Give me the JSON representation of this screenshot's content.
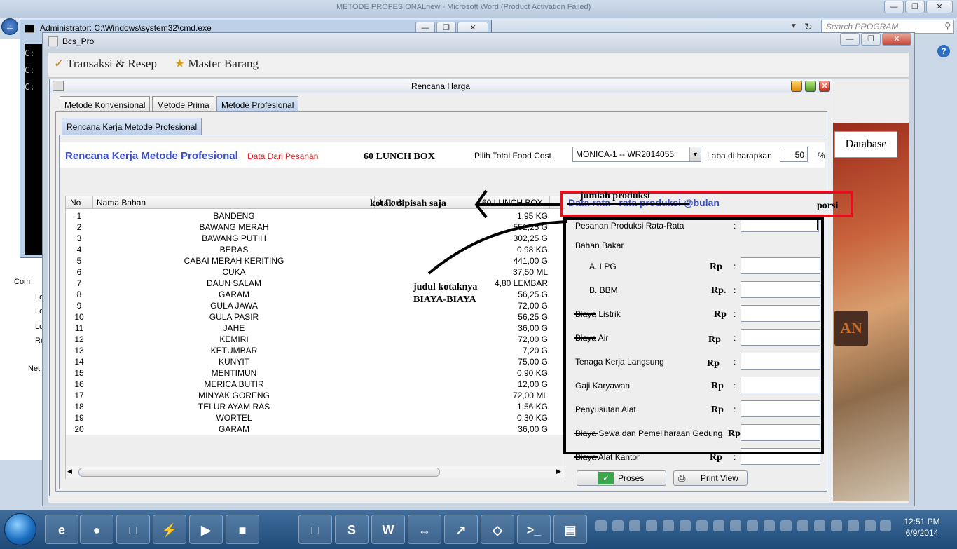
{
  "background": {
    "word_title": "METODE PROFESIONALnew - Microsoft Word (Product Activation Failed)",
    "search_placeholder": "Search PROGRAM",
    "explorer_items": [
      "Com",
      "Lo",
      "Lo",
      "Lo",
      "Re",
      "Net"
    ],
    "cmd_title": "Administrator: C:\\Windows\\system32\\cmd.exe",
    "cmd_lines": [
      "C:",
      "C:",
      "C:"
    ]
  },
  "app": {
    "title": "Bcs_Pro",
    "menu": [
      "Transaksi & Resep",
      "Master Barang"
    ],
    "bg_database": "Database",
    "bg_an": "AN"
  },
  "window": {
    "title": "Rencana Harga",
    "tabs": [
      "Metode Konvensional",
      "Metode Prima",
      "Metode Profesional"
    ],
    "subtab": "Rencana Kerja Metode Profesional"
  },
  "header": {
    "heading": "Rencana Kerja Metode Profesional",
    "source": "Data Dari Pesanan",
    "product": "60 LUNCH BOX",
    "foodcost_label": "Pilih Total Food Cost",
    "foodcost_value": "MONICA-1 -- WR2014055",
    "profit_label": "Laba di harapkan",
    "profit_value": "50",
    "percent": "%"
  },
  "table": {
    "columns": [
      "No",
      "Nama Bahan",
      "1 Porsi",
      "60 LUNCH BOX"
    ],
    "rows": [
      [
        "1",
        "BANDENG",
        "",
        "1,95 KG"
      ],
      [
        "2",
        "BAWANG MERAH",
        "",
        "551,25 G"
      ],
      [
        "3",
        "BAWANG PUTIH",
        "",
        "302,25 G"
      ],
      [
        "4",
        "BERAS",
        "",
        "0,98 KG"
      ],
      [
        "5",
        "CABAI MERAH KERITING",
        "",
        "441,00 G"
      ],
      [
        "6",
        "CUKA",
        "",
        "37,50 ML"
      ],
      [
        "7",
        "DAUN SALAM",
        "",
        "4,80 LEMBAR"
      ],
      [
        "8",
        "GARAM",
        "",
        "56,25 G"
      ],
      [
        "9",
        "GULA JAWA",
        "",
        "72,00 G"
      ],
      [
        "10",
        "GULA PASIR",
        "",
        "56,25 G"
      ],
      [
        "11",
        "JAHE",
        "",
        "36,00 G"
      ],
      [
        "12",
        "KEMIRI",
        "",
        "72,00 G"
      ],
      [
        "13",
        "KETUMBAR",
        "",
        "7,20 G"
      ],
      [
        "14",
        "KUNYIT",
        "",
        "75,00 G"
      ],
      [
        "15",
        "MENTIMUN",
        "",
        "0,90 KG"
      ],
      [
        "16",
        "MERICA BUTIR",
        "",
        "12,00 G"
      ],
      [
        "17",
        "MINYAK GORENG",
        "",
        "72,00 ML"
      ],
      [
        "18",
        "TELUR AYAM RAS",
        "",
        "1,56 KG"
      ],
      [
        "19",
        "WORTEL",
        "",
        "0,30 KG"
      ],
      [
        "20",
        "GARAM",
        "",
        "36,00 G"
      ]
    ]
  },
  "right": {
    "heading": "Data rata - rata produksi @bulan",
    "production_label": "Pesanan Produksi Rata-Rata",
    "bahan_bakar": "Bahan Bakar",
    "rp": "Rp",
    "rp_dot": "Rp.",
    "colon": ":",
    "fields": [
      "A. LPG",
      "B. BBM",
      "Biaya Listrik",
      "Biaya Air",
      "Tenaga Kerja Langsung",
      "Gaji Karyawan",
      "Penyusutan Alat",
      "Biaya Sewa dan Pemeliharaan Gedung",
      "Biaya Alat Kantor"
    ],
    "proses": "Proses",
    "print_view": "Print View"
  },
  "annotations": {
    "jumlah": "jumlah produksi",
    "porsi": "porsi",
    "kotak": "kotak dipisah saja",
    "judul1": "judul kotaknya",
    "judul2": "BIAYA-BIAYA"
  },
  "taskbar": {
    "time": "12:51 PM",
    "date": "6/9/2014"
  }
}
